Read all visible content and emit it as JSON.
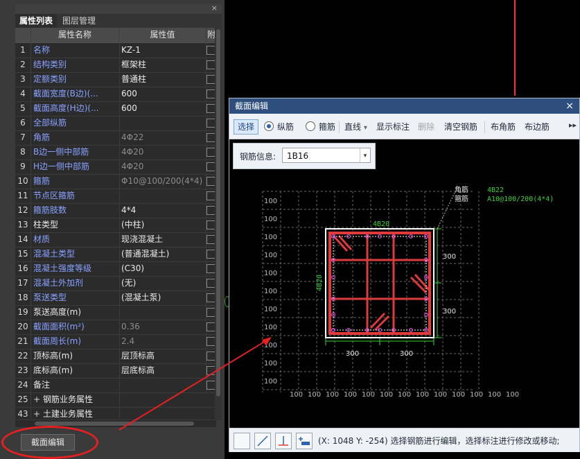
{
  "left_panel": {
    "close_glyph": "×",
    "tabs": [
      "属性列表",
      "图层管理"
    ],
    "header": {
      "idx": "",
      "name": "属性名称",
      "value": "属性值",
      "extra": "附"
    },
    "rows": [
      {
        "idx": "1",
        "name": "名称",
        "value": "KZ-1",
        "name_color": "blue"
      },
      {
        "idx": "2",
        "name": "结构类别",
        "value": "框架柱",
        "name_color": "blue"
      },
      {
        "idx": "3",
        "name": "定额类别",
        "value": "普通柱",
        "name_color": "blue"
      },
      {
        "idx": "4",
        "name": "截面宽度(B边)(...",
        "value": "600",
        "name_color": "blue"
      },
      {
        "idx": "5",
        "name": "截面高度(H边)(...",
        "value": "600",
        "name_color": "blue"
      },
      {
        "idx": "6",
        "name": "全部纵筋",
        "value": "",
        "name_color": "blue"
      },
      {
        "idx": "7",
        "name": "角筋",
        "value": "4Φ22",
        "name_color": "blue",
        "value_grey": true
      },
      {
        "idx": "8",
        "name": "B边一侧中部筋",
        "value": "4Φ20",
        "name_color": "blue",
        "value_grey": true
      },
      {
        "idx": "9",
        "name": "H边一侧中部筋",
        "value": "4Φ20",
        "name_color": "blue",
        "value_grey": true
      },
      {
        "idx": "10",
        "name": "箍筋",
        "value": "Φ10@100/200(4*4)",
        "name_color": "blue",
        "value_grey": true
      },
      {
        "idx": "11",
        "name": "节点区箍筋",
        "value": "",
        "name_color": "blue"
      },
      {
        "idx": "12",
        "name": "箍筋肢数",
        "value": "4*4",
        "name_color": "blue"
      },
      {
        "idx": "13",
        "name": "柱类型",
        "value": "(中柱)",
        "name_color": "white"
      },
      {
        "idx": "14",
        "name": "材质",
        "value": "现浇混凝土",
        "name_color": "blue"
      },
      {
        "idx": "15",
        "name": "混凝土类型",
        "value": "(普通混凝土)",
        "name_color": "blue"
      },
      {
        "idx": "16",
        "name": "混凝土强度等级",
        "value": "(C30)",
        "name_color": "blue"
      },
      {
        "idx": "17",
        "name": "混凝土外加剂",
        "value": "(无)",
        "name_color": "blue"
      },
      {
        "idx": "18",
        "name": "泵送类型",
        "value": "(混凝土泵)",
        "name_color": "blue"
      },
      {
        "idx": "19",
        "name": "泵送高度(m)",
        "value": "",
        "name_color": "white"
      },
      {
        "idx": "20",
        "name": "截面面积(m²)",
        "value": "0.36",
        "name_color": "blue",
        "value_grey": true
      },
      {
        "idx": "21",
        "name": "截面周长(m)",
        "value": "2.4",
        "name_color": "blue",
        "value_grey": true
      },
      {
        "idx": "22",
        "name": "顶标高(m)",
        "value": "层顶标高",
        "name_color": "white"
      },
      {
        "idx": "23",
        "name": "底标高(m)",
        "value": "层底标高",
        "name_color": "white"
      },
      {
        "idx": "24",
        "name": "备注",
        "value": "",
        "name_color": "white"
      },
      {
        "idx": "25",
        "name": "钢筋业务属性",
        "value": "",
        "name_color": "white",
        "expandable": true
      },
      {
        "idx": "43",
        "name": "土建业务属性",
        "value": "",
        "name_color": "white",
        "expandable": true
      }
    ],
    "expander_glyph": "+",
    "edit_button": "截面编辑"
  },
  "dialog": {
    "title": "截面编辑",
    "close_glyph": "×",
    "toolbar": {
      "select": "选择",
      "radio_longitudinal": "纵筋",
      "radio_stirrup": "箍筋",
      "line": "直线",
      "line_caret": "▾",
      "show_dim": "显示标注",
      "delete": "删除",
      "clear": "清空钢筋",
      "corner": "布角筋",
      "edge": "布边筋",
      "more": "▸▸"
    },
    "info": {
      "label": "钢筋信息:",
      "value": "1B16",
      "arrow": "▾"
    },
    "drawing": {
      "legend_corner": "角筋",
      "legend_stirrup": "箍筋",
      "corner_spec": "4B22",
      "stirrup_spec": "A10@100/200(4*4)",
      "top_label": "4B20",
      "left_label": "4B20",
      "dim_right": [
        "300",
        "300"
      ],
      "dim_bottom": [
        "300",
        "300"
      ],
      "grid_left_labels": [
        "100",
        "100",
        "100",
        "100",
        "100",
        "100",
        "100",
        "100",
        "100",
        "100",
        "100"
      ],
      "grid_bottom_labels": [
        "100",
        "100",
        "100",
        "100",
        "100",
        "100",
        "100",
        "100",
        "100",
        "100",
        "100",
        "100",
        "100"
      ]
    },
    "status": {
      "coord_text": "(X: 1048 Y: -254)  选择钢筋进行编辑，选择标注进行修改或移动;"
    }
  },
  "colors": {
    "dialog_title_bar": "#2e4f7e",
    "rebar_red": "#e03a3a",
    "dim_green": "#39d339",
    "bar_magenta": "#d04ad0",
    "annotation_arrow": "#e62020"
  }
}
